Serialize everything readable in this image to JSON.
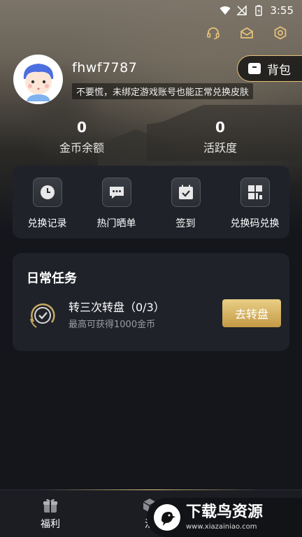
{
  "status_bar": {
    "time": "3:55"
  },
  "profile": {
    "username": "fhwf7787",
    "notice": "不要慌，未绑定游戏账号也能正常兑换皮肤",
    "bag_label": "背包"
  },
  "stats": {
    "coins": {
      "value": "0",
      "label": "金币余额"
    },
    "activity": {
      "value": "0",
      "label": "活跃度"
    }
  },
  "quick_actions": [
    {
      "label": "兑换记录",
      "icon": "clock-icon"
    },
    {
      "label": "热门晒单",
      "icon": "chat-icon"
    },
    {
      "label": "签到",
      "icon": "calendar-check-icon"
    },
    {
      "label": "兑换码兑换",
      "icon": "grid-code-icon"
    }
  ],
  "daily_tasks": {
    "title": "日常任务",
    "items": [
      {
        "name": "转三次转盘（0/3）",
        "subtitle": "最高可获得1000金币",
        "button": "去转盘"
      }
    ]
  },
  "bottom_nav": [
    {
      "label": "福利",
      "icon": "gift-icon"
    },
    {
      "label": "活",
      "icon": "box-icon"
    }
  ],
  "watermark": {
    "title": "下载鸟资源",
    "url": "www.xiazainiao.com"
  },
  "colors": {
    "accent_gold": "#e8c27a",
    "panel": "#1f2229",
    "background": "#14161c"
  }
}
